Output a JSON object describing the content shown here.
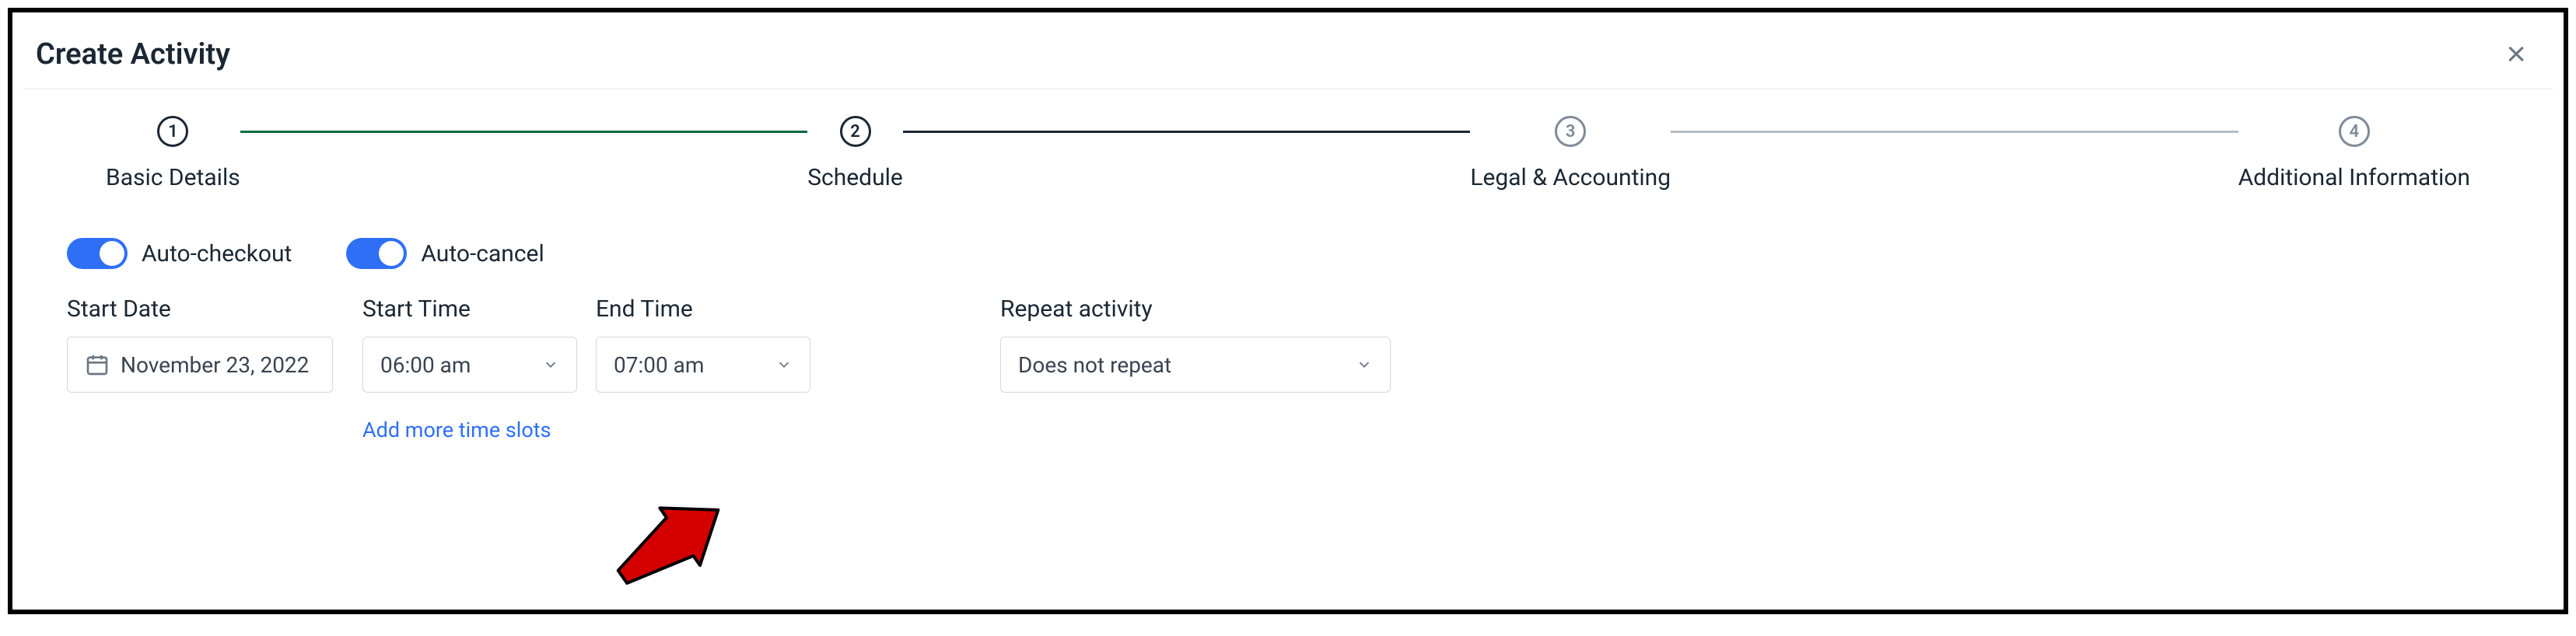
{
  "header": {
    "title": "Create Activity"
  },
  "stepper": {
    "steps": [
      {
        "num": "1",
        "label": "Basic Details"
      },
      {
        "num": "2",
        "label": "Schedule"
      },
      {
        "num": "3",
        "label": "Legal & Accounting"
      },
      {
        "num": "4",
        "label": "Additional Information"
      }
    ]
  },
  "form": {
    "toggles": {
      "auto_checkout_label": "Auto-checkout",
      "auto_cancel_label": "Auto-cancel"
    },
    "labels": {
      "start_date": "Start Date",
      "start_time": "Start Time",
      "end_time": "End Time",
      "repeat": "Repeat activity"
    },
    "values": {
      "start_date": "November 23, 2022",
      "start_time": "06:00 am",
      "end_time": "07:00 am",
      "repeat": "Does not repeat"
    },
    "add_more_slots_label": "Add more time slots"
  }
}
